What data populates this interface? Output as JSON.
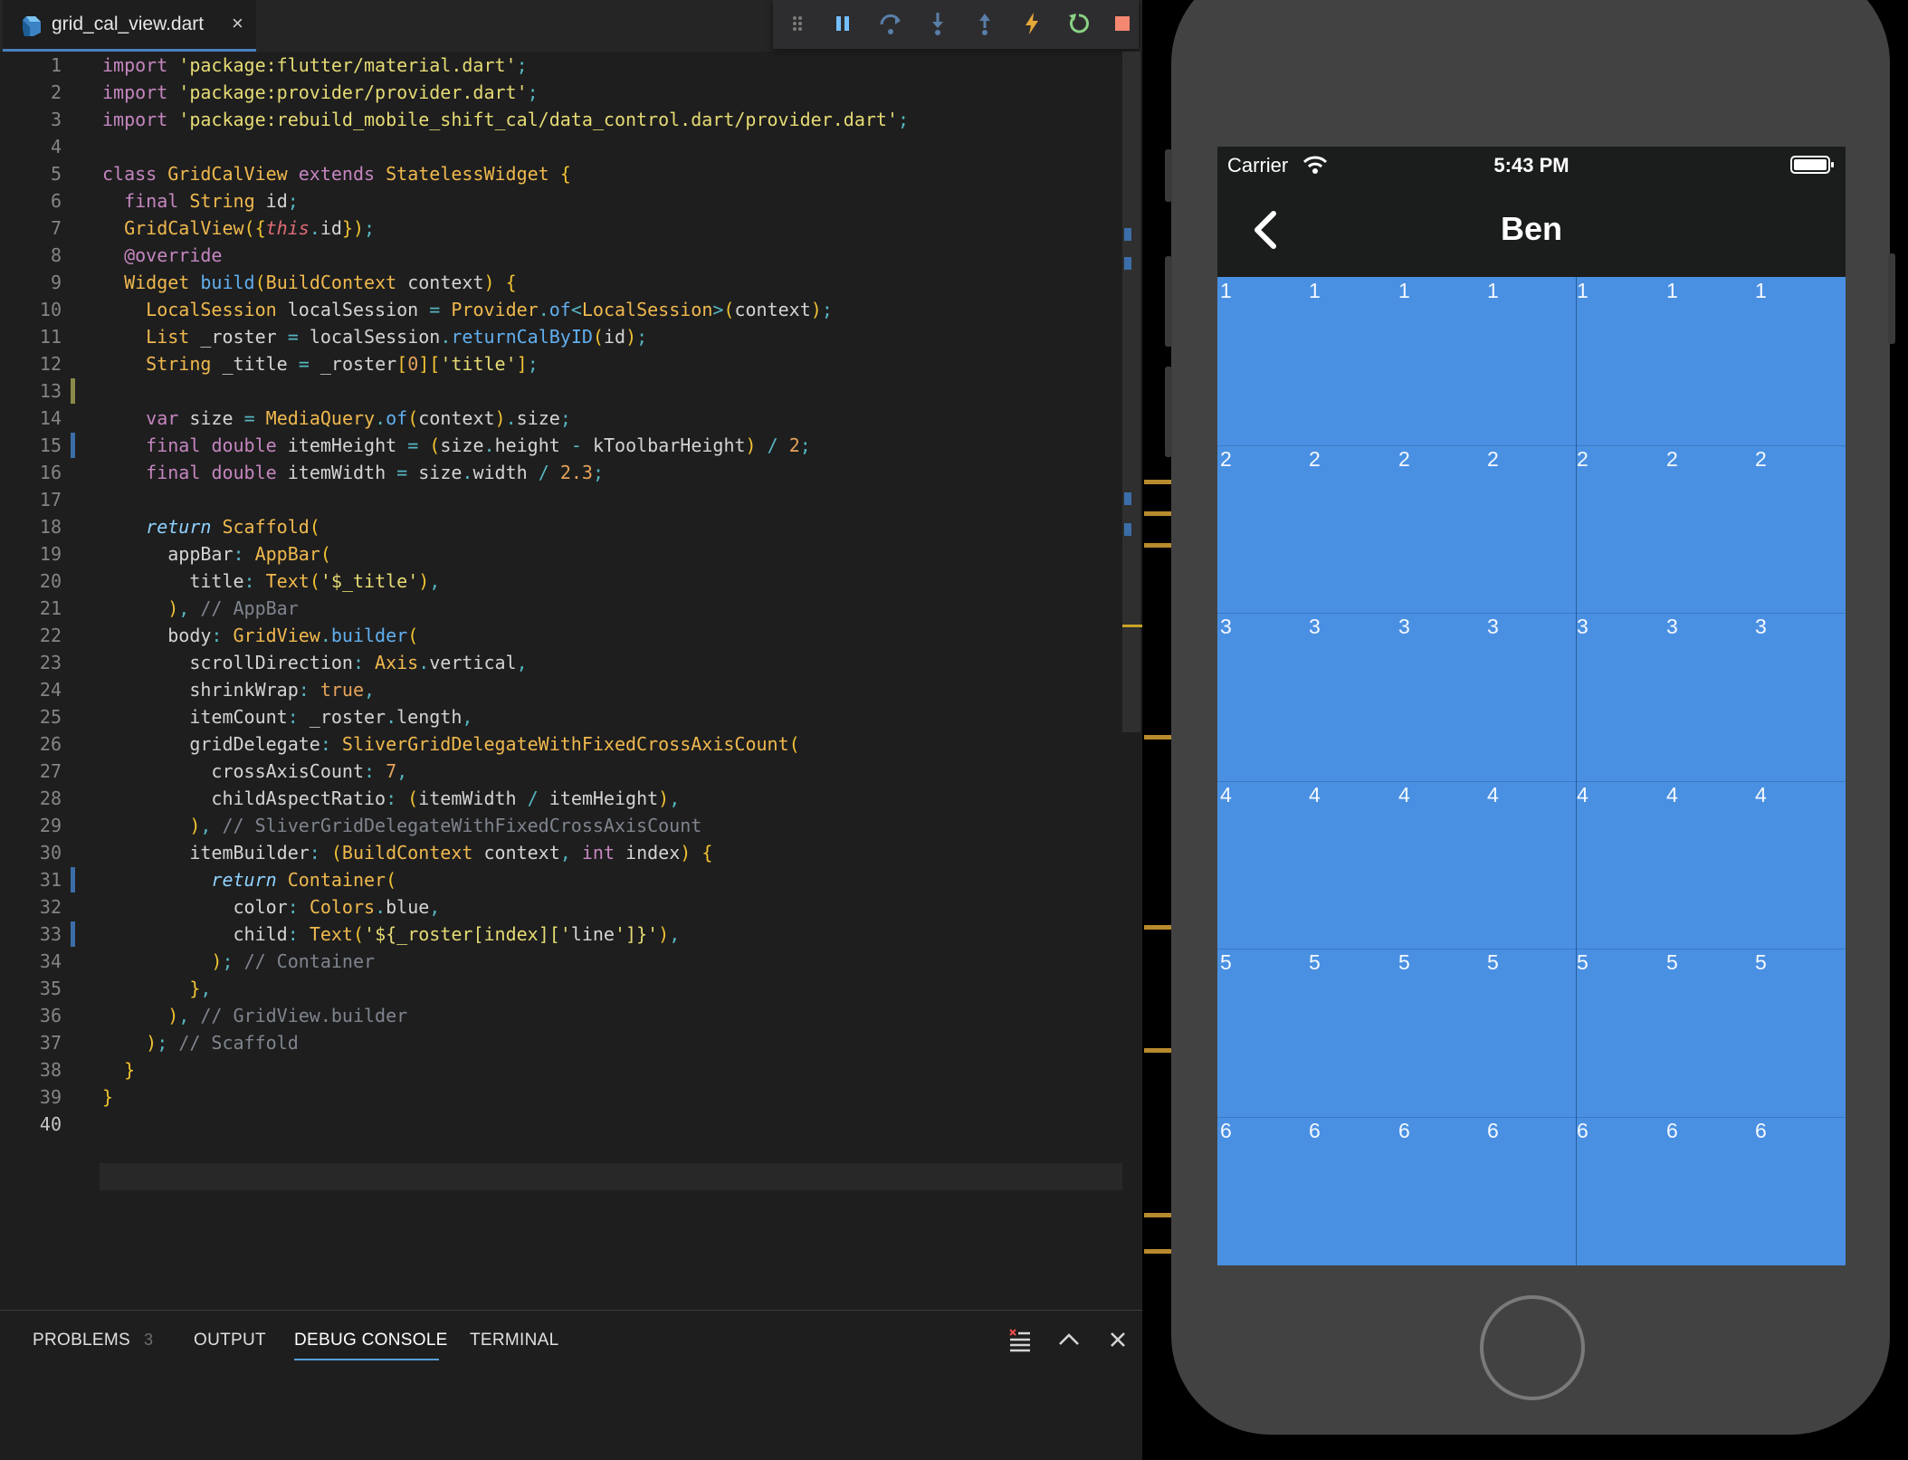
{
  "editor": {
    "tab": {
      "filename": "grid_cal_view.dart",
      "close": "×"
    },
    "toolbar": [
      "drag-handle",
      "pause",
      "step-over",
      "step-into",
      "step-out",
      "hot-reload",
      "restart",
      "stop"
    ],
    "current_line": 40,
    "code_lines": [
      "import 'package:flutter/material.dart';",
      "import 'package:provider/provider.dart';",
      "import 'package:rebuild_mobile_shift_cal/data_control.dart/provider.dart';",
      "",
      "class GridCalView extends StatelessWidget {",
      "  final String id;",
      "  GridCalView({this.id});",
      "  @override",
      "  Widget build(BuildContext context) {",
      "    LocalSession localSession = Provider.of<LocalSession>(context);",
      "    List _roster = localSession.returnCalByID(id);",
      "    String _title = _roster[0]['title'];",
      "",
      "    var size = MediaQuery.of(context).size;",
      "    final double itemHeight = (size.height - kToolbarHeight) / 2;",
      "    final double itemWidth = size.width / 2.3;",
      "",
      "    return Scaffold(",
      "      appBar: AppBar(",
      "        title: Text('$_title'),",
      "      ), // AppBar",
      "      body: GridView.builder(",
      "        scrollDirection: Axis.vertical,",
      "        shrinkWrap: true,",
      "        itemCount: _roster.length,",
      "        gridDelegate: SliverGridDelegateWithFixedCrossAxisCount(",
      "          crossAxisCount: 7,",
      "          childAspectRatio: (itemWidth / itemHeight),",
      "        ), // SliverGridDelegateWithFixedCrossAxisCount",
      "        itemBuilder: (BuildContext context, int index) {",
      "          return Container(",
      "            color: Colors.blue,",
      "            child: Text('${_roster[index]['line']}'),",
      "          ); // Container",
      "        },",
      "      ), // GridView.builder",
      "    ); // Scaffold",
      "  }",
      "}",
      ""
    ]
  },
  "panel": {
    "tabs": [
      {
        "label": "PROBLEMS",
        "badge": "3"
      },
      {
        "label": "OUTPUT"
      },
      {
        "label": "DEBUG CONSOLE",
        "active": true
      },
      {
        "label": "TERMINAL"
      }
    ]
  },
  "phone": {
    "status": {
      "carrier": "Carrier",
      "time": "5:43 PM"
    },
    "appbar_title": "Ben",
    "grid": {
      "columns": 7,
      "rows": [
        [
          "1",
          "1",
          "1",
          "1",
          "1",
          "1",
          "1"
        ],
        [
          "2",
          "2",
          "2",
          "2",
          "2",
          "2",
          "2"
        ],
        [
          "3",
          "3",
          "3",
          "3",
          "3",
          "3",
          "3"
        ],
        [
          "4",
          "4",
          "4",
          "4",
          "4",
          "4",
          "4"
        ],
        [
          "5",
          "5",
          "5",
          "5",
          "5",
          "5",
          "5"
        ],
        [
          "6",
          "6",
          "6",
          "6",
          "6",
          "6",
          "6"
        ]
      ],
      "color": "#4a90e2"
    }
  }
}
